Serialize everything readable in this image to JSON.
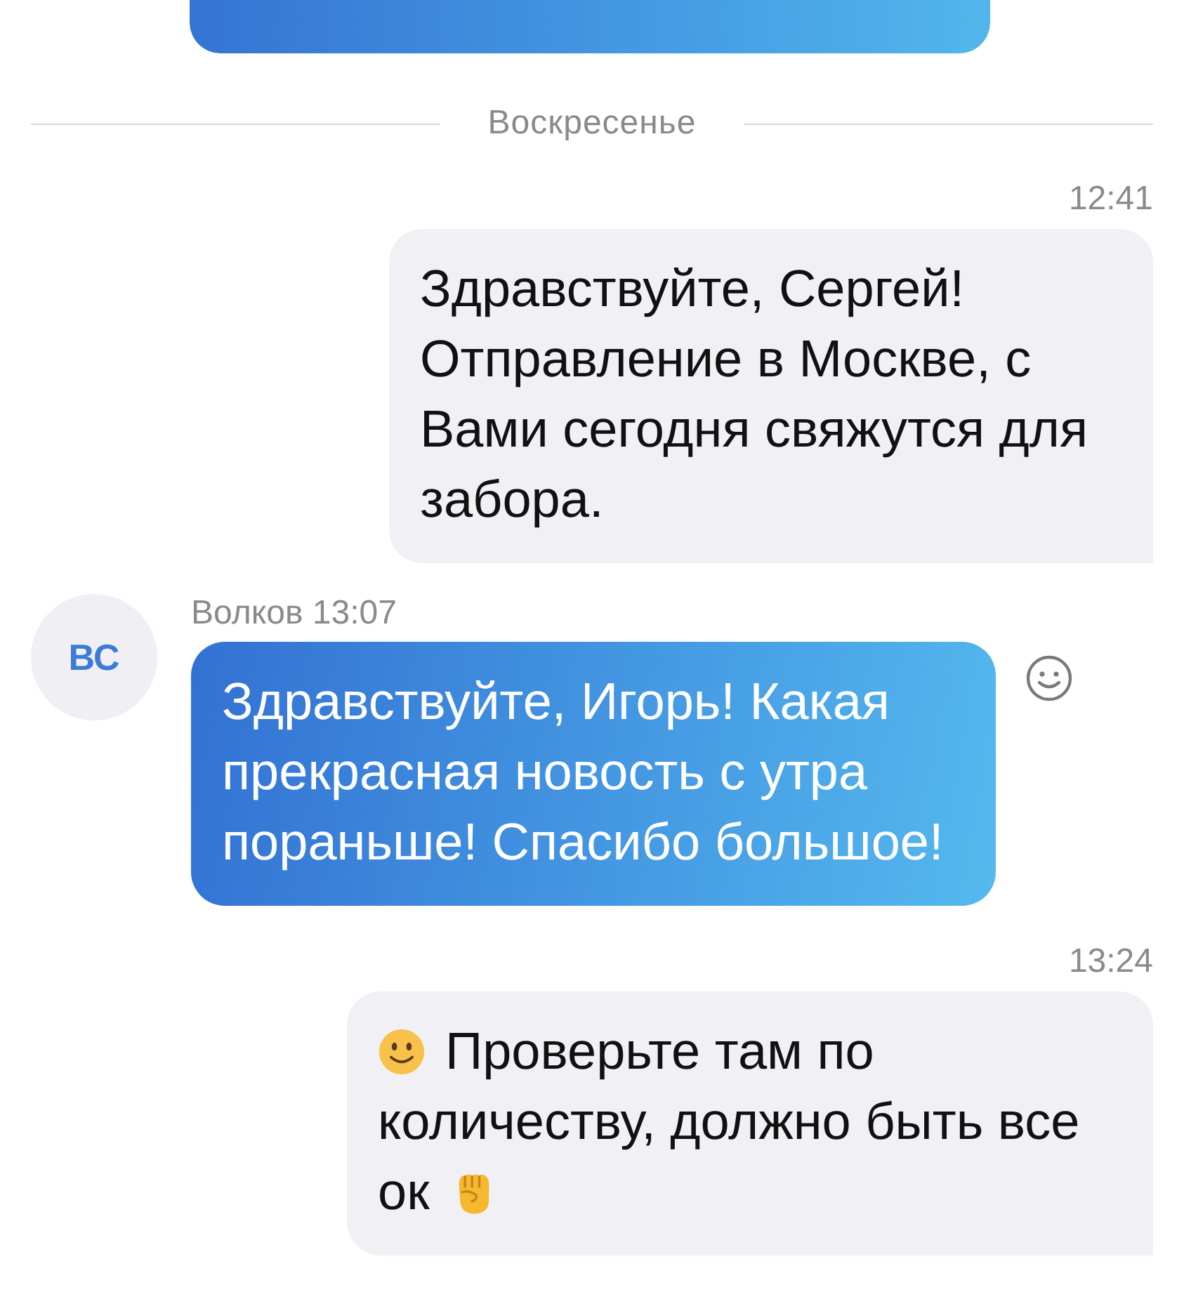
{
  "date_separator": "Воскресенье",
  "messages": [
    {
      "kind": "outgoing",
      "time": "12:41",
      "lines": [
        [
          {
            "kind": "text",
            "text": "Здравствуйте, Сергей! Отправление в Москве, с Вами сегодня свяжутся для забора."
          }
        ]
      ]
    },
    {
      "kind": "incoming",
      "avatar": "ВС",
      "author": "Волков 13:07",
      "lines": [
        [
          {
            "kind": "text",
            "text": "Здравствуйте, Игорь! Какая прекрасная новость с утра пораньше! Спасибо большое!"
          }
        ]
      ]
    },
    {
      "kind": "outgoing",
      "time": "13:24",
      "lines": [
        [
          {
            "kind": "smile-emoji"
          },
          {
            "kind": "text",
            "text": "Проверьте там по"
          }
        ],
        [
          {
            "kind": "text",
            "text": "количеству, должно быть все"
          }
        ],
        [
          {
            "kind": "text",
            "text": "ок"
          },
          {
            "kind": "fist-emoji"
          }
        ]
      ]
    }
  ]
}
